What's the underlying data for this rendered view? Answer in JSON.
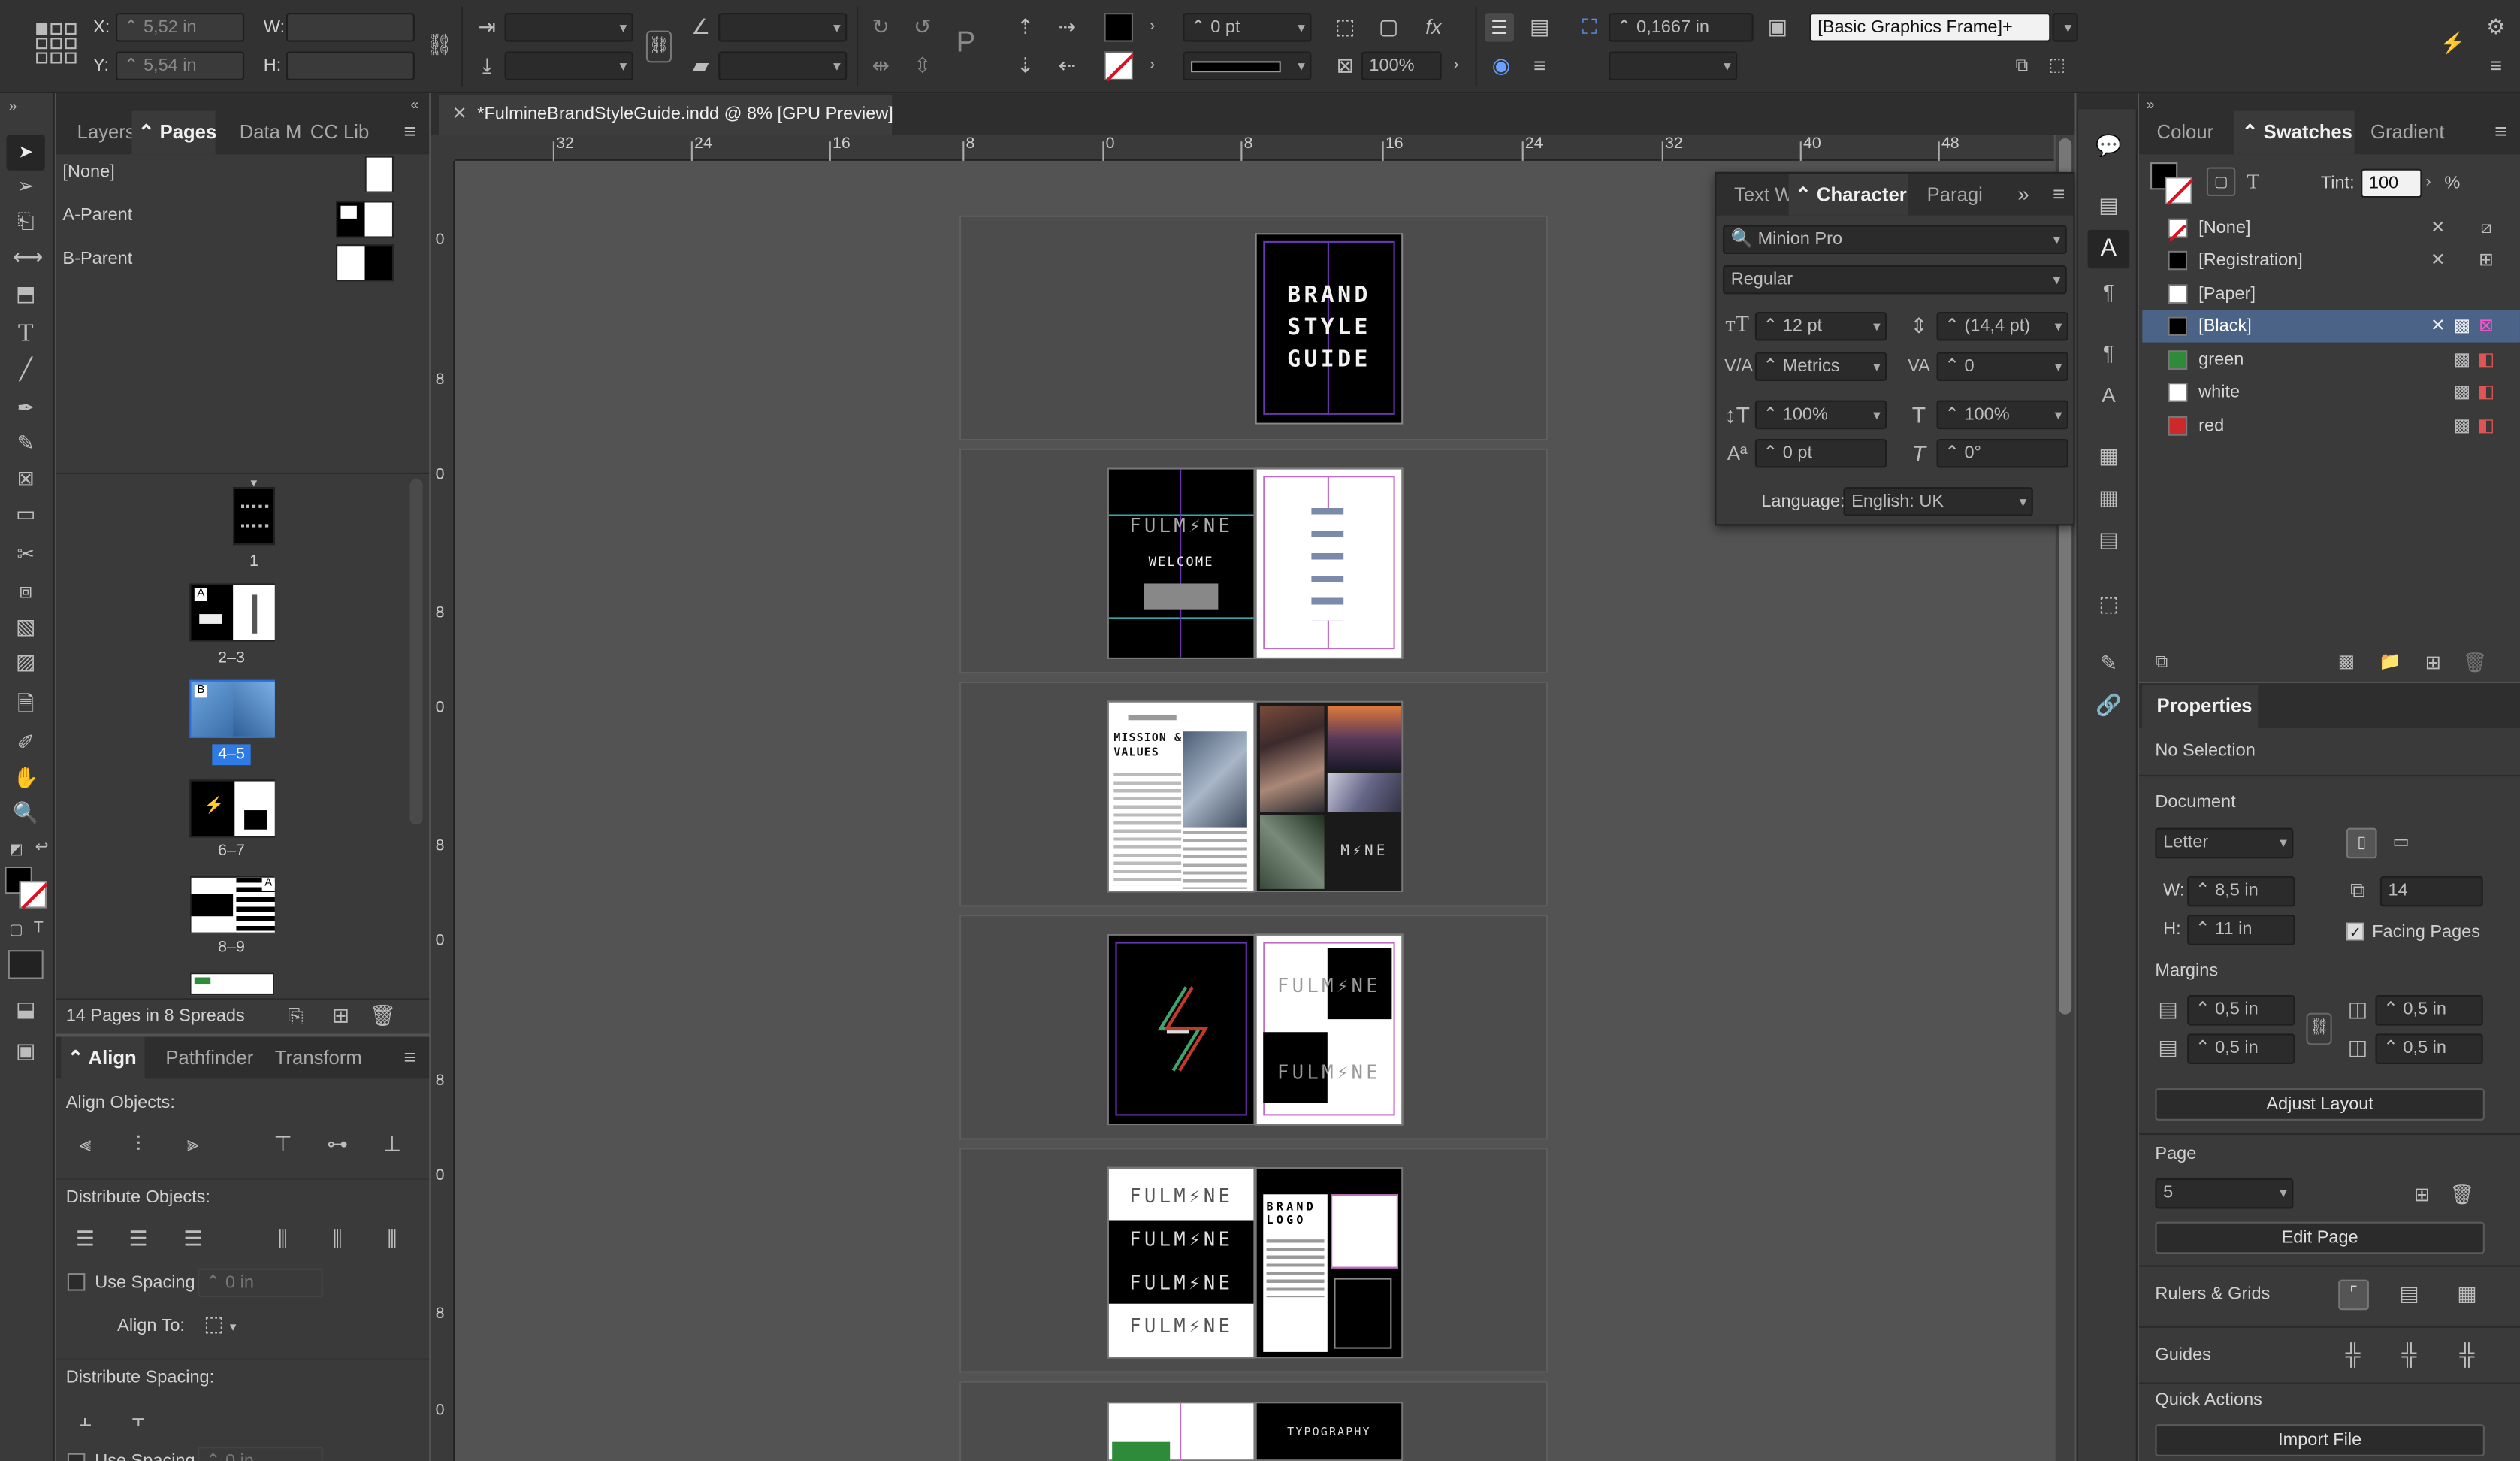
{
  "controlbar": {
    "x_label": "X:",
    "x_value": "5,52 in",
    "y_label": "Y:",
    "y_value": "5,54 in",
    "w_label": "W:",
    "h_label": "H:",
    "stroke_weight": "0 pt",
    "opacity": "100%",
    "offset": "0,1667 in",
    "object_style": "[Basic Graphics Frame]+"
  },
  "left_panel": {
    "tabs": [
      "Layers",
      "Pages",
      "Data M",
      "CC Lib"
    ],
    "masters": [
      "[None]",
      "A-Parent",
      "B-Parent"
    ],
    "page_labels": [
      "1",
      "2–3",
      "4–5",
      "6–7",
      "8–9"
    ],
    "footer": "14 Pages in 8 Spreads"
  },
  "align_panel": {
    "tabs": [
      "Align",
      "Pathfinder",
      "Transform"
    ],
    "align_objects": "Align Objects:",
    "distribute_objects": "Distribute Objects:",
    "use_spacing": "Use Spacing",
    "spacing_value": "0 in",
    "align_to": "Align To:",
    "distribute_spacing": "Distribute Spacing:",
    "use_spacing2": "Use Spacing",
    "spacing_value2": "0 in"
  },
  "document": {
    "tab_title": "*FulmineBrandStyleGuide.indd @ 8% [GPU Preview]",
    "ruler_h": [
      "32",
      "24",
      "16",
      "8",
      "0",
      "8",
      "16",
      "24",
      "32",
      "40",
      "48"
    ],
    "ruler_v": [
      "0",
      "8",
      "0",
      "8",
      "0",
      "8",
      "0",
      "8",
      "0",
      "8",
      "0"
    ]
  },
  "pages_art": {
    "cover": [
      "BRAND",
      "STYLE",
      "GUIDE"
    ],
    "spread2_left_title": "FULM⚡NE",
    "spread2_welcome": "WELCOME",
    "spread3_title": "MISSION & VALUES",
    "spread3_right": "M⚡NE",
    "spread4_right": "FULM⚡NE",
    "spread5_rows": [
      "FULM⚡NE",
      "FULM⚡NE",
      "FULM⚡NE",
      "FULM⚡NE"
    ],
    "spread5_brand": "BRAND LOGO",
    "spread6_typo": "TYPOGRAPHY"
  },
  "character_panel": {
    "tabs": [
      "Text W",
      "Character",
      "Paragi"
    ],
    "font": "Minion Pro",
    "style": "Regular",
    "size": "12 pt",
    "leading": "(14,4 pt)",
    "kerning": "Metrics",
    "tracking": "0",
    "vscale": "100%",
    "hscale": "100%",
    "baseline": "0 pt",
    "skew": "0°",
    "language_label": "Language:",
    "language": "English: UK"
  },
  "swatches_panel": {
    "tabs": [
      "Colour",
      "Swatches",
      "Gradient"
    ],
    "tint_label": "Tint:",
    "tint": "100",
    "tint_unit": "%",
    "swatches": [
      {
        "name": "[None]",
        "color": "#ffffff"
      },
      {
        "name": "[Registration]",
        "color": "#000000"
      },
      {
        "name": "[Paper]",
        "color": "#ffffff"
      },
      {
        "name": "[Black]",
        "color": "#000000"
      },
      {
        "name": "green",
        "color": "#2e8b3a"
      },
      {
        "name": "white",
        "color": "#ffffff"
      },
      {
        "name": "red",
        "color": "#cc2a2a"
      }
    ]
  },
  "properties_panel": {
    "title": "Properties",
    "selection": "No Selection",
    "document_heading": "Document",
    "page_size": "Letter",
    "w_label": "W:",
    "w": "8,5 in",
    "h_label": "H:",
    "h": "11 in",
    "pages_count": "14",
    "facing_pages": "Facing Pages",
    "margins_heading": "Margins",
    "margin_top": "0,5 in",
    "margin_bottom": "0,5 in",
    "margin_left": "0,5 in",
    "margin_right": "0,5 in",
    "adjust_layout": "Adjust Layout",
    "page_heading": "Page",
    "page_value": "5",
    "edit_page": "Edit Page",
    "rulers_grids": "Rulers & Grids",
    "guides": "Guides",
    "quick_actions": "Quick Actions",
    "import_file": "Import File"
  }
}
